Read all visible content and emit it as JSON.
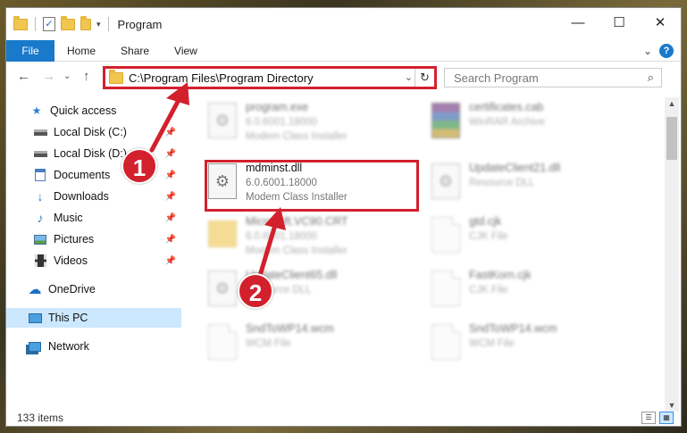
{
  "window": {
    "title": "Program",
    "controls": {
      "minimize": "—",
      "maximize": "☐",
      "close": "✕"
    }
  },
  "ribbon": {
    "tabs": [
      "File",
      "Home",
      "Share",
      "View"
    ],
    "expand_glyph": "⌄",
    "help_glyph": "?"
  },
  "address": {
    "path": "C:\\Program Files\\Program Directory",
    "dropdown_glyph": "⌄",
    "refresh_glyph": "↻"
  },
  "search": {
    "placeholder": "Search Program"
  },
  "nav_glyphs": {
    "back": "←",
    "forward": "→",
    "recent": "⌄",
    "up": "↑"
  },
  "sidebar": {
    "items": [
      {
        "label": "Quick access",
        "icon": "star-icon"
      },
      {
        "label": "Local Disk (C:)",
        "icon": "drive-icon",
        "pinned": true
      },
      {
        "label": "Local Disk (D:)",
        "icon": "drive-icon",
        "pinned": true
      },
      {
        "label": "Documents",
        "icon": "documents-icon",
        "pinned": true
      },
      {
        "label": "Downloads",
        "icon": "downloads-icon",
        "pinned": true
      },
      {
        "label": "Music",
        "icon": "music-icon",
        "pinned": true
      },
      {
        "label": "Pictures",
        "icon": "pictures-icon",
        "pinned": true
      },
      {
        "label": "Videos",
        "icon": "videos-icon",
        "pinned": true
      },
      {
        "label": "OneDrive",
        "icon": "cloud-icon"
      },
      {
        "label": "This PC",
        "icon": "computer-icon",
        "selected": true
      },
      {
        "label": "Network",
        "icon": "network-icon"
      }
    ]
  },
  "files": [
    {
      "name": "program.exe",
      "line2": "6.0.6001.18000",
      "line3": "Modem Class Installer",
      "icon": "exe-icon"
    },
    {
      "name": "certificates.cab",
      "line2": "WinRAR Archive",
      "line3": "",
      "icon": "rar-icon"
    },
    {
      "name": "mdminst.dll",
      "line2": "6.0.6001.18000",
      "line3": "Modem Class Installer",
      "icon": "dll-icon",
      "highlighted": true
    },
    {
      "name": "UpdateClient21.dll",
      "line2": "Resource DLL",
      "line3": "",
      "icon": "dll-icon"
    },
    {
      "name": "Microsoft.VC90.CRT",
      "line2": "6.0.6001.18000",
      "line3": "Modem Class Installer",
      "icon": "folder-icon"
    },
    {
      "name": "gtd.cjk",
      "line2": "CJK File",
      "line3": "",
      "icon": "file-icon"
    },
    {
      "name": "UpdateClient65.dll",
      "line2": "Resource DLL",
      "line3": "",
      "icon": "dll-icon"
    },
    {
      "name": "FastKorn.cjk",
      "line2": "CJK File",
      "line3": "",
      "icon": "file-icon"
    },
    {
      "name": "SndToWP14.wcm",
      "line2": "WCM File",
      "line3": "",
      "icon": "file-icon"
    },
    {
      "name": "SndToWP14.wcm",
      "line2": "WCM File",
      "line3": "",
      "icon": "file-icon"
    }
  ],
  "status": {
    "item_count": "133 items"
  },
  "annotations": {
    "step1": "1",
    "step2": "2",
    "color": "#d3202d"
  }
}
